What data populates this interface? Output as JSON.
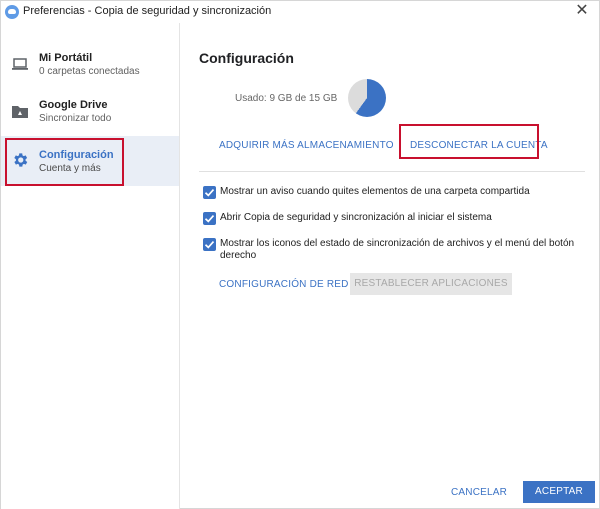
{
  "window": {
    "title": "Preferencias - Copia de seguridad y sincronización",
    "close_glyph": "✕"
  },
  "sidebar": {
    "items": [
      {
        "title": "Mi Portátil",
        "subtitle": "0 carpetas conectadas",
        "icon": "laptop-icon"
      },
      {
        "title": "Google Drive",
        "subtitle": "Sincronizar todo",
        "icon": "drive-folder-icon"
      },
      {
        "title": "Configuración",
        "subtitle": "Cuenta y más",
        "icon": "gear-icon",
        "active": true
      }
    ]
  },
  "main": {
    "title": "Configuración",
    "storage": {
      "text": "Usado: 9 GB de 15 GB",
      "used_fraction": 0.6
    },
    "buy_storage_label": "ADQUIRIR MÁS ALMACENAMIENTO",
    "disconnect_label": "DESCONECTAR LA CUENTA",
    "options": [
      {
        "label": "Mostrar un aviso cuando quites elementos de una carpeta compartida",
        "checked": true
      },
      {
        "label": "Abrir Copia de seguridad y sincronización al iniciar el sistema",
        "checked": true
      },
      {
        "label": "Mostrar los iconos del estado de sincronización de archivos y el menú del botón derecho",
        "checked": true
      }
    ],
    "network_label": "CONFIGURACIÓN DE RED",
    "reset_apps_label": "RESTABLECER APLICACIONES"
  },
  "footer": {
    "cancel_label": "CANCELAR",
    "accept_label": "ACEPTAR"
  },
  "colors": {
    "accent": "#3b72c4",
    "highlight": "#c8102e",
    "active_bg": "#e9eef6"
  }
}
